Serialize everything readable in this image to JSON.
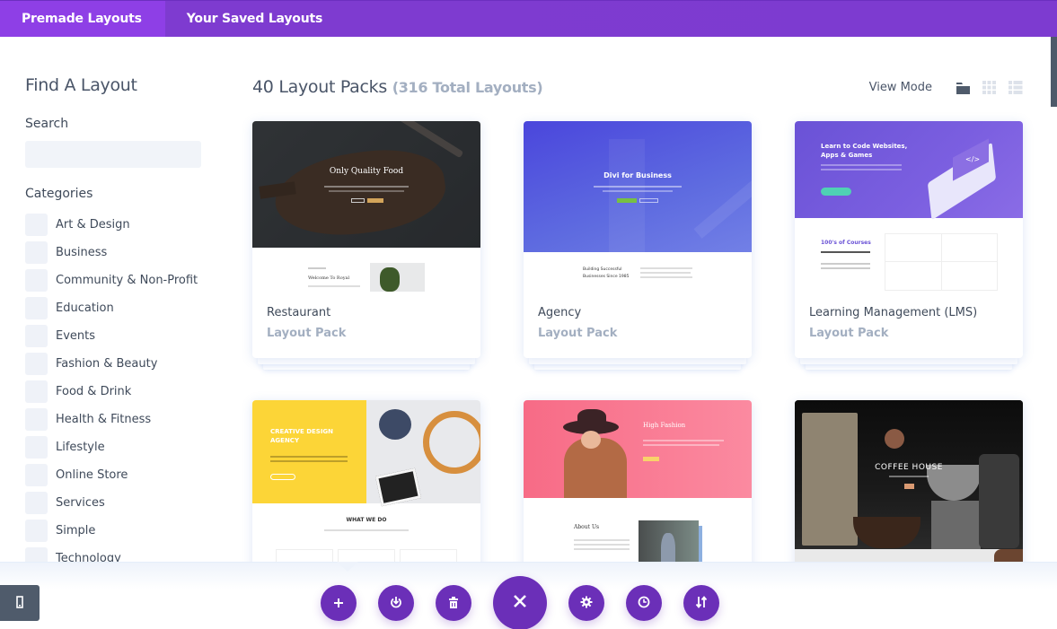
{
  "tabs": [
    {
      "label": "Premade Layouts",
      "active": true
    },
    {
      "label": "Your Saved Layouts",
      "active": false
    }
  ],
  "sidebar": {
    "title": "Find A Layout",
    "search_label": "Search",
    "search_value": "",
    "search_placeholder": "",
    "categories_label": "Categories",
    "categories": [
      "Art & Design",
      "Business",
      "Community & Non-Profit",
      "Education",
      "Events",
      "Fashion & Beauty",
      "Food & Drink",
      "Health & Fitness",
      "Lifestyle",
      "Online Store",
      "Services",
      "Simple",
      "Technology"
    ]
  },
  "main": {
    "title": "40 Layout Packs",
    "count": "(316 Total Layouts)",
    "view_mode_label": "View Mode",
    "view_modes": [
      "folder-view",
      "grid-view",
      "list-view"
    ],
    "active_view_mode": "folder-view",
    "cards": [
      {
        "title": "Restaurant",
        "subtitle": "Layout Pack",
        "thumb_heading": "Only Quality Food",
        "thumb_sub": "Welcome To Royal"
      },
      {
        "title": "Agency",
        "subtitle": "Layout Pack",
        "thumb_heading": "Divi for Business",
        "thumb_sub": "Building Successful Businesses Since 1985"
      },
      {
        "title": "Learning Management (LMS)",
        "subtitle": "Layout Pack",
        "thumb_heading": "Learn to Code Websites, Apps & Games",
        "thumb_sub": "100's of Courses"
      },
      {
        "title": "",
        "subtitle": "",
        "thumb_heading": "CREATIVE DESIGN AGENCY",
        "thumb_sub": "WHAT WE DO"
      },
      {
        "title": "",
        "subtitle": "",
        "thumb_heading": "High Fashion",
        "thumb_sub": "About Us"
      },
      {
        "title": "",
        "subtitle": "",
        "thumb_heading": "COFFEE HOUSE",
        "thumb_sub": ""
      }
    ]
  },
  "toolbar": {
    "buttons": [
      {
        "name": "add",
        "icon": "plus-icon"
      },
      {
        "name": "load",
        "icon": "power-download-icon"
      },
      {
        "name": "clear",
        "icon": "trash-icon"
      },
      {
        "name": "close",
        "icon": "close-icon"
      },
      {
        "name": "settings",
        "icon": "gear-icon"
      },
      {
        "name": "history",
        "icon": "clock-icon"
      },
      {
        "name": "portability",
        "icon": "sort-arrows-icon"
      }
    ],
    "accent_color": "#6b2fb8"
  },
  "colors": {
    "topbar": "#7d3bd0",
    "active_tab": "#8e3fe6",
    "text": "#4a5568",
    "muted": "#a3afc1"
  }
}
